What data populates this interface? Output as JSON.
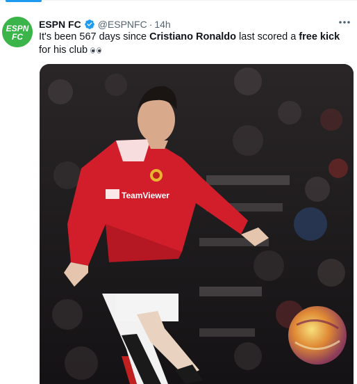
{
  "tweet": {
    "display_name": "ESPN FC",
    "handle": "@ESPNFC",
    "separator": "·",
    "time": "14h",
    "text_parts": {
      "p1": "It's been 567 days since ",
      "b1": "Cristiano Ronaldo",
      "p2": " last scored a ",
      "b2": "free kick",
      "p3": " for his club"
    },
    "emoji": "eyes",
    "verified": true
  },
  "avatar": {
    "lines": [
      "ESPN",
      "FC"
    ],
    "color": "#3bb54a"
  },
  "media": {
    "jersey_text": "TeamViewer"
  },
  "colors": {
    "accent": "#1d9bf0",
    "text": "#0f1419",
    "secondary": "#536471"
  },
  "icons": [
    "verified-badge-icon",
    "more-options-icon",
    "eyes-emoji-icon"
  ]
}
